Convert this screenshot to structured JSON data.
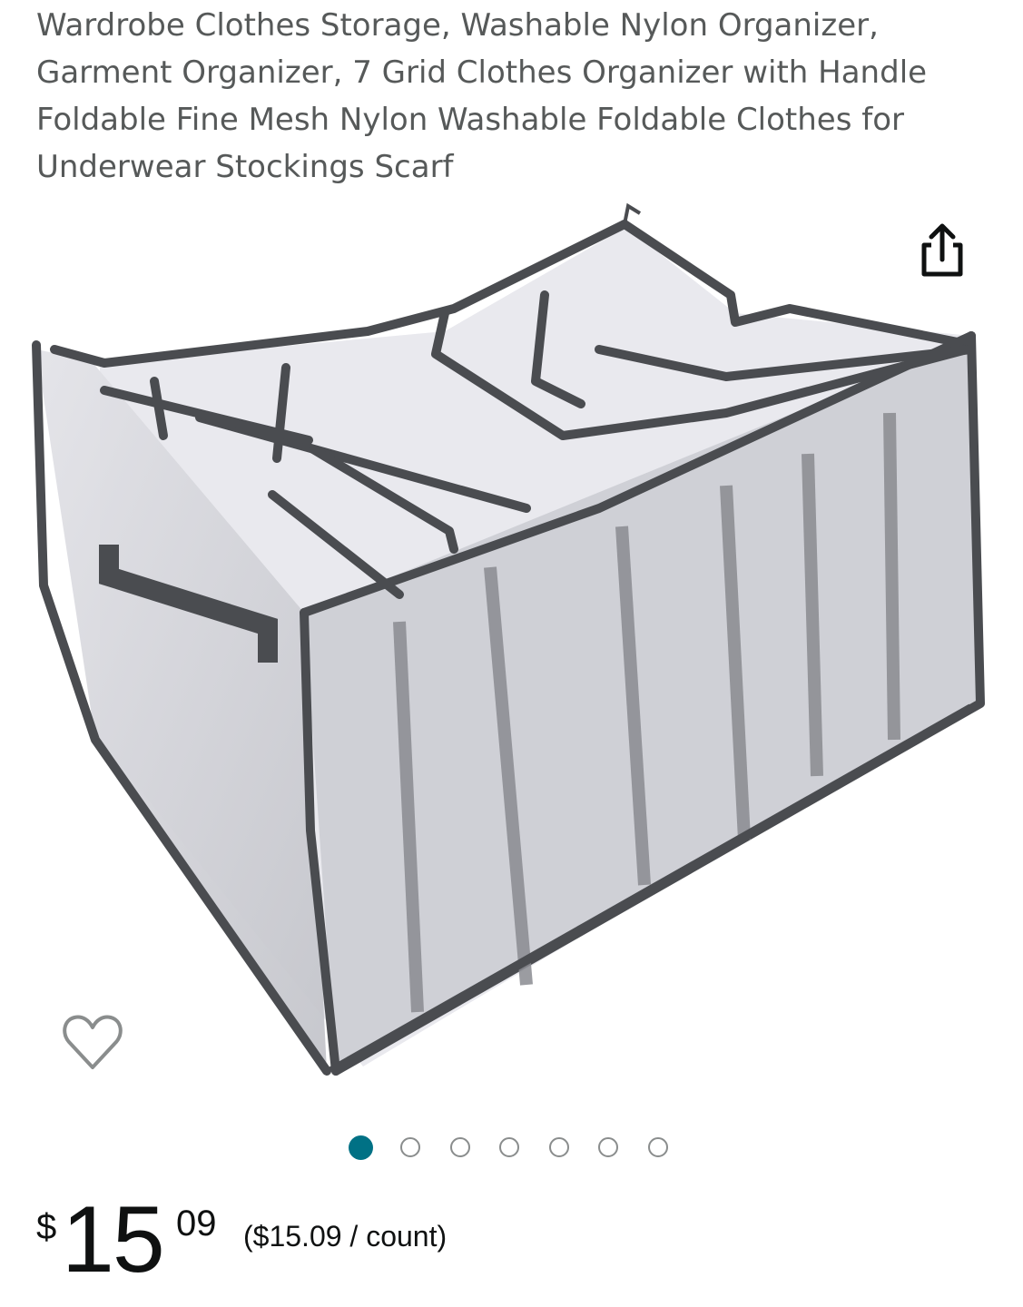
{
  "product": {
    "title": "Wardrobe Clothes Storage, Washable Nylon Organizer, Garment Organizer, 7 Grid Clothes Organizer with Handle Foldable Fine Mesh Nylon Washable Foldable Clothes for Underwear Stockings Scarf"
  },
  "icons": {
    "share": "share-icon",
    "wishlist": "heart-icon"
  },
  "gallery": {
    "image_count": 7,
    "active_index": 0,
    "active_dot_color": "#007185",
    "inactive_dot_color": "#8a8d8d"
  },
  "price": {
    "symbol": "$",
    "whole": "15",
    "fraction": "09",
    "per_unit": "($15.09 / count)"
  },
  "colors": {
    "title_text": "#565959",
    "price_text": "#0f1111",
    "mesh_trim": "#4a4c50",
    "mesh_fill": "#c9cacf"
  }
}
